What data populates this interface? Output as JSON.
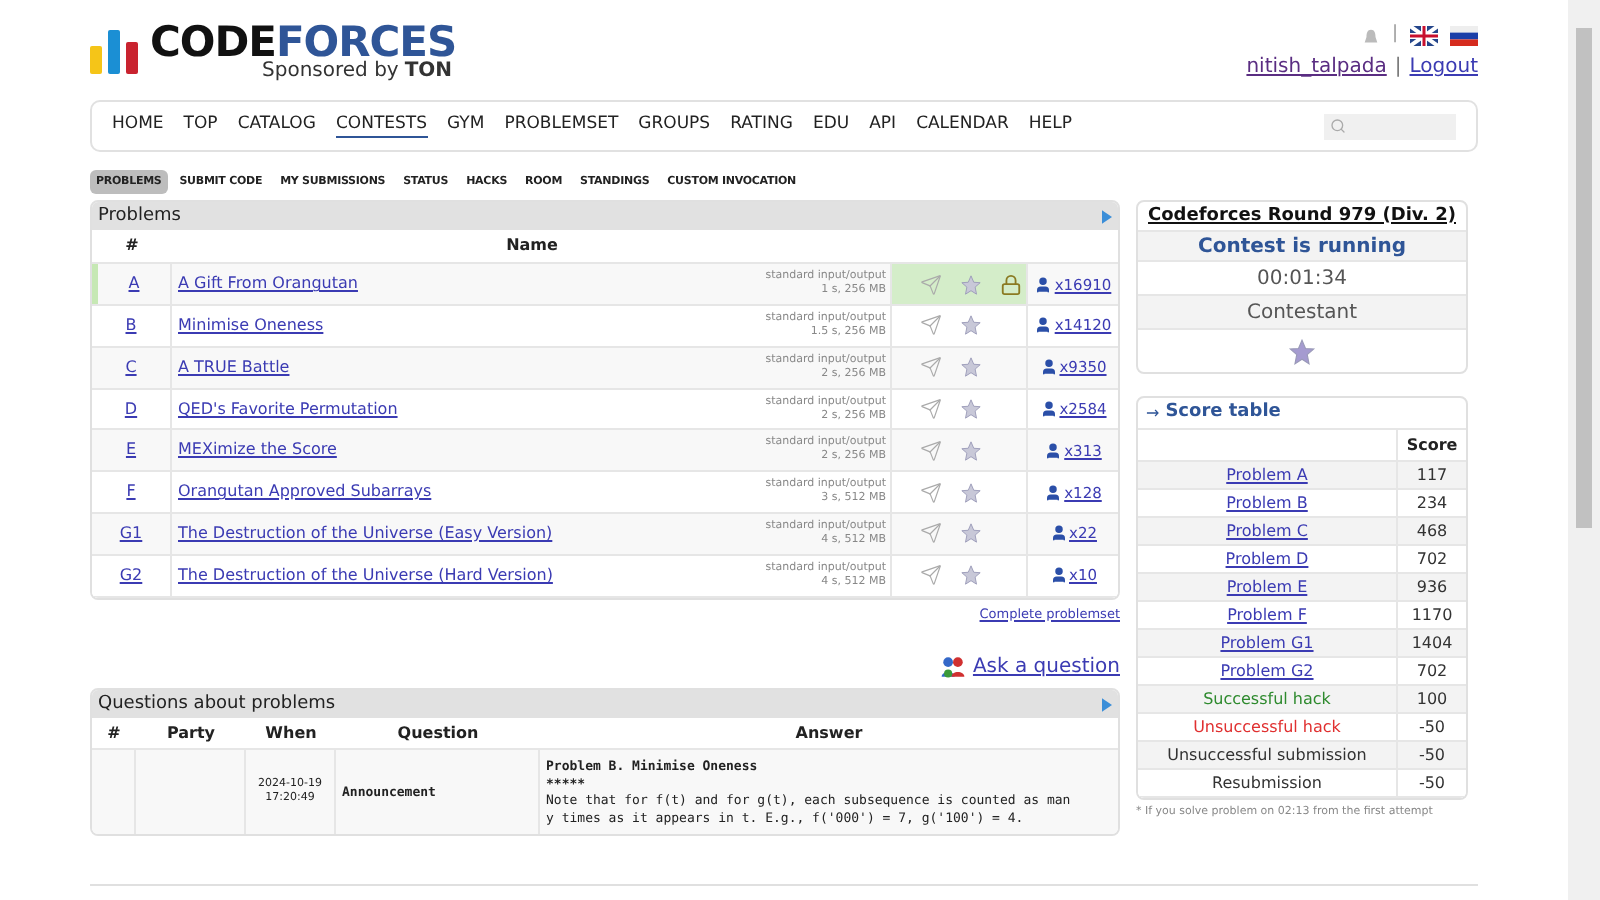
{
  "header": {
    "logo": {
      "word_dark": "CODE",
      "word_blue": "FORCES",
      "sponsor": "Sponsored by",
      "sponsor_brand": "TON"
    },
    "top_separator": "|",
    "user": "nitish_talpada",
    "link_separator": "|",
    "logout": "Logout"
  },
  "nav": [
    {
      "label": "HOME",
      "selected": false
    },
    {
      "label": "TOP",
      "selected": false
    },
    {
      "label": "CATALOG",
      "selected": false
    },
    {
      "label": "CONTESTS",
      "selected": true
    },
    {
      "label": "GYM",
      "selected": false
    },
    {
      "label": "PROBLEMSET",
      "selected": false
    },
    {
      "label": "GROUPS",
      "selected": false
    },
    {
      "label": "RATING",
      "selected": false
    },
    {
      "label": "EDU",
      "selected": false
    },
    {
      "label": "API",
      "selected": false
    },
    {
      "label": "CALENDAR",
      "selected": false
    },
    {
      "label": "HELP",
      "selected": false
    }
  ],
  "second_menu": [
    {
      "label": "PROBLEMS",
      "selected": true
    },
    {
      "label": "SUBMIT CODE",
      "selected": false
    },
    {
      "label": "MY SUBMISSIONS",
      "selected": false
    },
    {
      "label": "STATUS",
      "selected": false
    },
    {
      "label": "HACKS",
      "selected": false
    },
    {
      "label": "ROOM",
      "selected": false
    },
    {
      "label": "STANDINGS",
      "selected": false
    },
    {
      "label": "CUSTOM INVOCATION",
      "selected": false
    }
  ],
  "problems": {
    "title": "Problems",
    "columns": [
      "#",
      "Name"
    ],
    "rows": [
      {
        "index": "A",
        "name": "A Gift From Orangutan",
        "io": "standard input/output",
        "limits": "1 s, 256 MB",
        "solvers": "x16910",
        "accepted": true
      },
      {
        "index": "B",
        "name": "Minimise Oneness",
        "io": "standard input/output",
        "limits": "1.5 s, 256 MB",
        "solvers": "x14120",
        "accepted": false
      },
      {
        "index": "C",
        "name": "A TRUE Battle",
        "io": "standard input/output",
        "limits": "2 s, 256 MB",
        "solvers": "x9350",
        "accepted": false
      },
      {
        "index": "D",
        "name": "QED's Favorite Permutation",
        "io": "standard input/output",
        "limits": "2 s, 256 MB",
        "solvers": "x2584",
        "accepted": false
      },
      {
        "index": "E",
        "name": "MEXimize the Score",
        "io": "standard input/output",
        "limits": "2 s, 256 MB",
        "solvers": "x313",
        "accepted": false
      },
      {
        "index": "F",
        "name": "Orangutan Approved Subarrays",
        "io": "standard input/output",
        "limits": "3 s, 512 MB",
        "solvers": "x128",
        "accepted": false
      },
      {
        "index": "G1",
        "name": "The Destruction of the Universe (Easy Version)",
        "io": "standard input/output",
        "limits": "4 s, 512 MB",
        "solvers": "x22",
        "accepted": false
      },
      {
        "index": "G2",
        "name": "The Destruction of the Universe (Hard Version)",
        "io": "standard input/output",
        "limits": "4 s, 512 MB",
        "solvers": "x10",
        "accepted": false
      }
    ],
    "complete_link": "Complete problemset"
  },
  "ask_question": "Ask a question",
  "questions": {
    "title": "Questions about problems",
    "columns": [
      "#",
      "Party",
      "When",
      "Question",
      "Answer"
    ],
    "rows": [
      {
        "when_date": "2024-10-19",
        "when_time": "17:20:49",
        "question": "Announcement",
        "answer_title": "Problem B. Minimise Oneness",
        "answer_stars": "*****",
        "answer_lines": [
          "Note that for f(t) and for g(t), each subsequence is counted as man",
          "y times as it appears in t. E.g., f('000') = 7, g('100') = 4."
        ]
      }
    ]
  },
  "contest": {
    "name": "Codeforces Round 979 (Div. 2)",
    "status": "Contest is running",
    "timer": "00:01:34",
    "role": "Contestant"
  },
  "score_table": {
    "arrow": "→",
    "title": "Score table",
    "column": "Score",
    "rows": [
      {
        "kind": "problem",
        "label": "Problem A",
        "score": "117"
      },
      {
        "kind": "problem",
        "label": "Problem B",
        "score": "234"
      },
      {
        "kind": "problem",
        "label": "Problem C",
        "score": "468"
      },
      {
        "kind": "problem",
        "label": "Problem D",
        "score": "702"
      },
      {
        "kind": "problem",
        "label": "Problem E",
        "score": "936"
      },
      {
        "kind": "problem",
        "label": "Problem F",
        "score": "1170"
      },
      {
        "kind": "problem",
        "label": "Problem G1",
        "score": "1404"
      },
      {
        "kind": "problem",
        "label": "Problem G2",
        "score": "702"
      },
      {
        "kind": "success",
        "label": "Successful hack",
        "score": "100"
      },
      {
        "kind": "fail",
        "label": "Unsuccessful hack",
        "score": "-50"
      },
      {
        "kind": "plain",
        "label": "Unsuccessful submission",
        "score": "-50"
      },
      {
        "kind": "plain",
        "label": "Resubmission",
        "score": "-50"
      }
    ],
    "note": "* If you solve problem on 02:13 from the first attempt"
  }
}
